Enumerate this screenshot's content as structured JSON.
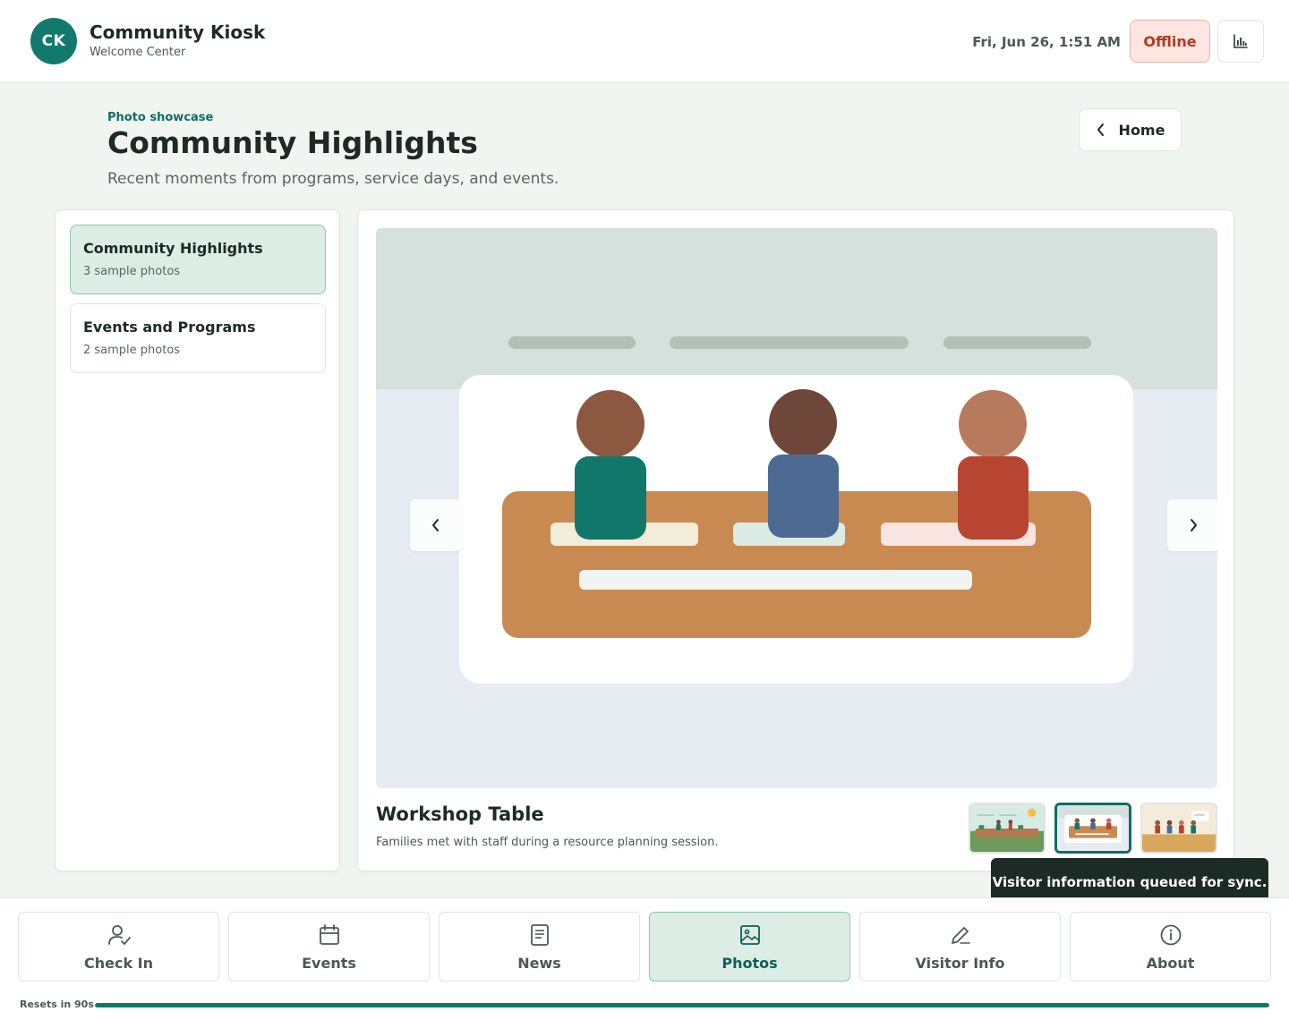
{
  "header": {
    "logo_initials": "CK",
    "app_title": "Community Kiosk",
    "app_subtitle": "Welcome Center",
    "datetime": "Fri, Jun 26, 1:51 AM",
    "status_label": "Offline",
    "stats_icon": "bar-chart-icon"
  },
  "page": {
    "eyebrow": "Photo showcase",
    "title": "Community Highlights",
    "description": "Recent moments from programs, service days, and events.",
    "home_label": "Home"
  },
  "albums": [
    {
      "name": "Community Highlights",
      "count": "3 sample photos",
      "active": true
    },
    {
      "name": "Events and Programs",
      "count": "2 sample photos",
      "active": false
    }
  ],
  "viewer": {
    "photo_title": "Workshop Table",
    "photo_caption": "Families met with staff during a resource planning session.",
    "thumbnails": [
      {
        "scene": "garden-outdoor",
        "active": false
      },
      {
        "scene": "workshop-table",
        "active": true
      },
      {
        "scene": "presentation",
        "active": false
      }
    ]
  },
  "toast": "Visitor information queued for sync.",
  "nav": [
    {
      "label": "Check In",
      "icon": "person-check-icon",
      "active": false
    },
    {
      "label": "Events",
      "icon": "calendar-icon",
      "active": false
    },
    {
      "label": "News",
      "icon": "document-icon",
      "active": false
    },
    {
      "label": "Photos",
      "icon": "image-icon",
      "active": true
    },
    {
      "label": "Visitor Info",
      "icon": "pencil-icon",
      "active": false
    },
    {
      "label": "About",
      "icon": "info-icon",
      "active": false
    }
  ],
  "reset": {
    "label": "Resets in 90s",
    "progress": 1.0
  },
  "colors": {
    "brand": "#127a6d",
    "offline": "#b23a22",
    "table": "#c98a52",
    "person_1_shirt": "#11776b",
    "person_2_shirt": "#4c6a92",
    "person_3_shirt": "#b84532"
  }
}
